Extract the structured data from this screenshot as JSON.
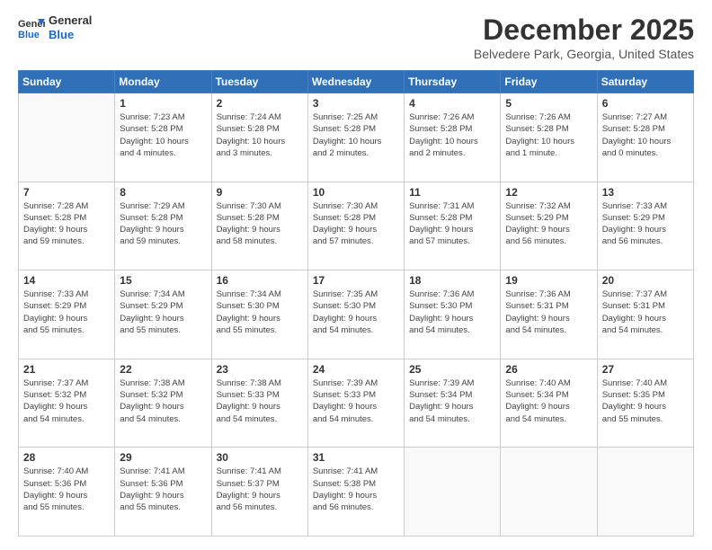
{
  "logo": {
    "line1": "General",
    "line2": "Blue"
  },
  "title": "December 2025",
  "location": "Belvedere Park, Georgia, United States",
  "days_of_week": [
    "Sunday",
    "Monday",
    "Tuesday",
    "Wednesday",
    "Thursday",
    "Friday",
    "Saturday"
  ],
  "weeks": [
    [
      {
        "day": "",
        "info": ""
      },
      {
        "day": "1",
        "info": "Sunrise: 7:23 AM\nSunset: 5:28 PM\nDaylight: 10 hours\nand 4 minutes."
      },
      {
        "day": "2",
        "info": "Sunrise: 7:24 AM\nSunset: 5:28 PM\nDaylight: 10 hours\nand 3 minutes."
      },
      {
        "day": "3",
        "info": "Sunrise: 7:25 AM\nSunset: 5:28 PM\nDaylight: 10 hours\nand 2 minutes."
      },
      {
        "day": "4",
        "info": "Sunrise: 7:26 AM\nSunset: 5:28 PM\nDaylight: 10 hours\nand 2 minutes."
      },
      {
        "day": "5",
        "info": "Sunrise: 7:26 AM\nSunset: 5:28 PM\nDaylight: 10 hours\nand 1 minute."
      },
      {
        "day": "6",
        "info": "Sunrise: 7:27 AM\nSunset: 5:28 PM\nDaylight: 10 hours\nand 0 minutes."
      }
    ],
    [
      {
        "day": "7",
        "info": "Sunrise: 7:28 AM\nSunset: 5:28 PM\nDaylight: 9 hours\nand 59 minutes."
      },
      {
        "day": "8",
        "info": "Sunrise: 7:29 AM\nSunset: 5:28 PM\nDaylight: 9 hours\nand 59 minutes."
      },
      {
        "day": "9",
        "info": "Sunrise: 7:30 AM\nSunset: 5:28 PM\nDaylight: 9 hours\nand 58 minutes."
      },
      {
        "day": "10",
        "info": "Sunrise: 7:30 AM\nSunset: 5:28 PM\nDaylight: 9 hours\nand 57 minutes."
      },
      {
        "day": "11",
        "info": "Sunrise: 7:31 AM\nSunset: 5:28 PM\nDaylight: 9 hours\nand 57 minutes."
      },
      {
        "day": "12",
        "info": "Sunrise: 7:32 AM\nSunset: 5:29 PM\nDaylight: 9 hours\nand 56 minutes."
      },
      {
        "day": "13",
        "info": "Sunrise: 7:33 AM\nSunset: 5:29 PM\nDaylight: 9 hours\nand 56 minutes."
      }
    ],
    [
      {
        "day": "14",
        "info": "Sunrise: 7:33 AM\nSunset: 5:29 PM\nDaylight: 9 hours\nand 55 minutes."
      },
      {
        "day": "15",
        "info": "Sunrise: 7:34 AM\nSunset: 5:29 PM\nDaylight: 9 hours\nand 55 minutes."
      },
      {
        "day": "16",
        "info": "Sunrise: 7:34 AM\nSunset: 5:30 PM\nDaylight: 9 hours\nand 55 minutes."
      },
      {
        "day": "17",
        "info": "Sunrise: 7:35 AM\nSunset: 5:30 PM\nDaylight: 9 hours\nand 54 minutes."
      },
      {
        "day": "18",
        "info": "Sunrise: 7:36 AM\nSunset: 5:30 PM\nDaylight: 9 hours\nand 54 minutes."
      },
      {
        "day": "19",
        "info": "Sunrise: 7:36 AM\nSunset: 5:31 PM\nDaylight: 9 hours\nand 54 minutes."
      },
      {
        "day": "20",
        "info": "Sunrise: 7:37 AM\nSunset: 5:31 PM\nDaylight: 9 hours\nand 54 minutes."
      }
    ],
    [
      {
        "day": "21",
        "info": "Sunrise: 7:37 AM\nSunset: 5:32 PM\nDaylight: 9 hours\nand 54 minutes."
      },
      {
        "day": "22",
        "info": "Sunrise: 7:38 AM\nSunset: 5:32 PM\nDaylight: 9 hours\nand 54 minutes."
      },
      {
        "day": "23",
        "info": "Sunrise: 7:38 AM\nSunset: 5:33 PM\nDaylight: 9 hours\nand 54 minutes."
      },
      {
        "day": "24",
        "info": "Sunrise: 7:39 AM\nSunset: 5:33 PM\nDaylight: 9 hours\nand 54 minutes."
      },
      {
        "day": "25",
        "info": "Sunrise: 7:39 AM\nSunset: 5:34 PM\nDaylight: 9 hours\nand 54 minutes."
      },
      {
        "day": "26",
        "info": "Sunrise: 7:40 AM\nSunset: 5:34 PM\nDaylight: 9 hours\nand 54 minutes."
      },
      {
        "day": "27",
        "info": "Sunrise: 7:40 AM\nSunset: 5:35 PM\nDaylight: 9 hours\nand 55 minutes."
      }
    ],
    [
      {
        "day": "28",
        "info": "Sunrise: 7:40 AM\nSunset: 5:36 PM\nDaylight: 9 hours\nand 55 minutes."
      },
      {
        "day": "29",
        "info": "Sunrise: 7:41 AM\nSunset: 5:36 PM\nDaylight: 9 hours\nand 55 minutes."
      },
      {
        "day": "30",
        "info": "Sunrise: 7:41 AM\nSunset: 5:37 PM\nDaylight: 9 hours\nand 56 minutes."
      },
      {
        "day": "31",
        "info": "Sunrise: 7:41 AM\nSunset: 5:38 PM\nDaylight: 9 hours\nand 56 minutes."
      },
      {
        "day": "",
        "info": ""
      },
      {
        "day": "",
        "info": ""
      },
      {
        "day": "",
        "info": ""
      }
    ]
  ]
}
